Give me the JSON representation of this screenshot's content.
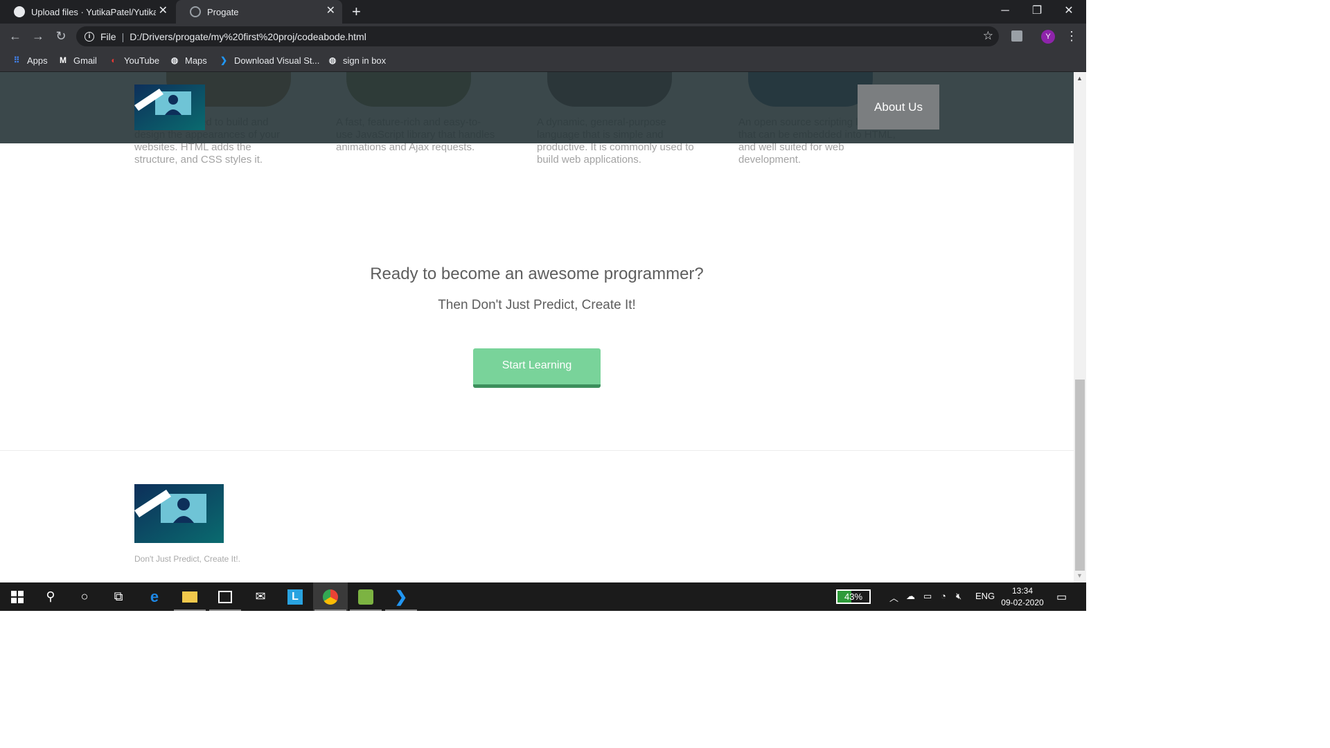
{
  "browser": {
    "tabs": [
      {
        "label": "Upload files · YutikaPatel/YutikaP",
        "active": false
      },
      {
        "label": "Progate",
        "active": true
      }
    ],
    "url_scheme": "File",
    "url": "D:/Drivers/progate/my%20first%20proj/codeabode.html",
    "profile_initial": "Y",
    "bookmarks": [
      {
        "label": "Apps",
        "icon": "apps-grid-icon"
      },
      {
        "label": "Gmail",
        "icon": "gmail-icon"
      },
      {
        "label": "YouTube",
        "icon": "youtube-icon"
      },
      {
        "label": "Maps",
        "icon": "globe-icon"
      },
      {
        "label": "Download Visual St...",
        "icon": "vscode-icon"
      },
      {
        "label": "sign in box",
        "icon": "globe-icon"
      }
    ]
  },
  "page": {
    "header": {
      "logo_alt": "Coders Abode",
      "about_label": "About Us"
    },
    "languages": [
      {
        "description": "A language used to build and design the appearances of your websites. HTML adds the structure, and CSS styles it.",
        "color": "#d9822b"
      },
      {
        "description": "A fast, feature-rich and easy-to-use JavaScript library that handles animations and Ajax requests.",
        "color": "#8a9a3c"
      },
      {
        "description": "A dynamic, general-purpose language that is simple and productive. It is commonly used to build web applications.",
        "color": "#5a4a4a"
      },
      {
        "description": "An open source scripting language that can be embedded into HTML, and well suited for web development.",
        "color": "#2f6e9c"
      }
    ],
    "cta": {
      "title": "Ready to become an awesome programmer?",
      "subtitle": "Then Don't Just Predict, Create It!",
      "button": "Start Learning"
    },
    "footer": {
      "logo_alt": "Coders Abode",
      "tagline": "Don't Just Predict, Create It!."
    }
  },
  "taskbar": {
    "battery": "43%",
    "battery_level": 0.43,
    "language": "ENG",
    "time": "13:34",
    "date": "09-02-2020"
  },
  "colors": {
    "cta_button": "#79d39a",
    "header_overlay": "#263437",
    "about_button": "#7b7e80"
  }
}
